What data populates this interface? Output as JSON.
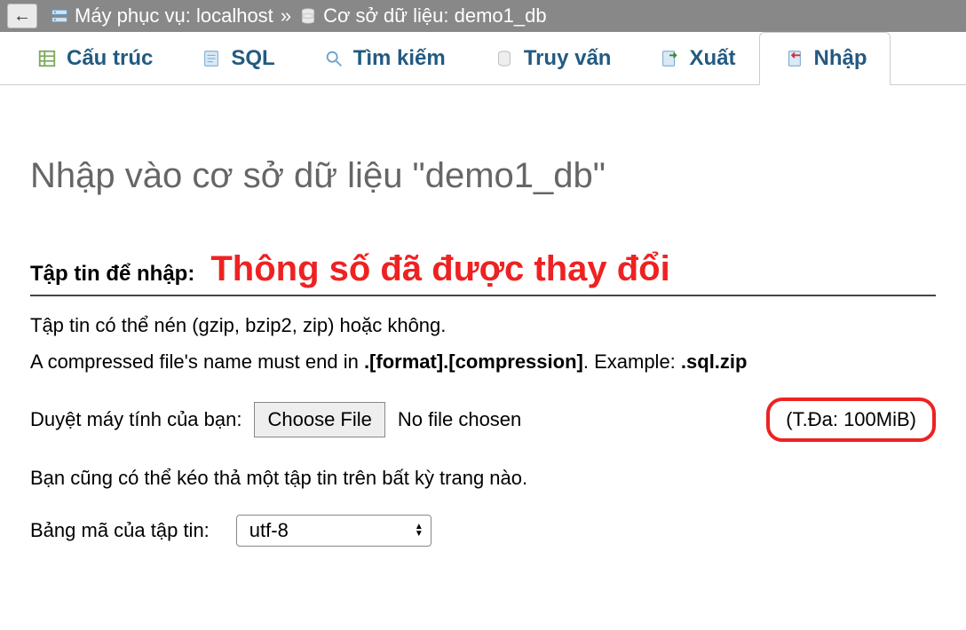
{
  "topbar": {
    "back_glyph": "←",
    "server_label": "Máy phục vụ:",
    "server_name": "localhost",
    "sep": "»",
    "db_label": "Cơ sở dữ liệu:",
    "db_name": "demo1_db"
  },
  "tabs": {
    "structure": "Cấu trúc",
    "sql": "SQL",
    "search": "Tìm kiếm",
    "query": "Truy vấn",
    "export": "Xuất",
    "import": "Nhập"
  },
  "heading": "Nhập vào cơ sở dữ liệu \"demo1_db\"",
  "section": {
    "label": "Tập tin để nhập:",
    "annotation": "Thông số đã được thay đổi"
  },
  "info": {
    "line1": "Tập tin có thể nén (gzip, bzip2, zip) hoặc không.",
    "line2_a": "A compressed file's name must end in ",
    "line2_b": ".[format].[compression]",
    "line2_c": ". Example: ",
    "line2_d": ".sql.zip"
  },
  "browse": {
    "label": "Duyệt máy tính của bạn:",
    "choose_btn": "Choose File",
    "no_file": "No file chosen",
    "max_size": "(T.Đa: 100MiB)"
  },
  "drag_line": "Bạn cũng có thể kéo thả một tập tin trên bất kỳ trang nào.",
  "charset": {
    "label": "Bảng mã của tập tin:",
    "value": "utf-8"
  }
}
